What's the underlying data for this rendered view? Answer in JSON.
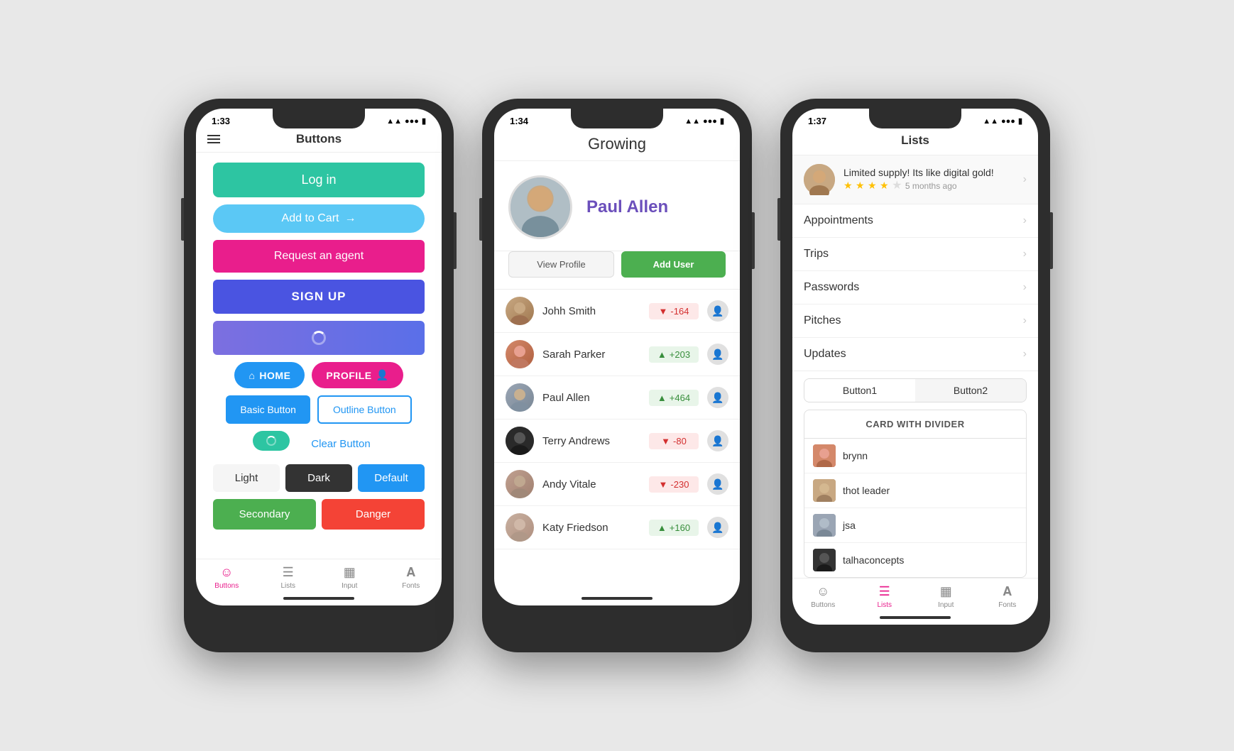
{
  "phone1": {
    "status_time": "1:33",
    "header_title": "Buttons",
    "buttons": {
      "login": "Log in",
      "add_cart": "Add to Cart",
      "request_agent": "Request an agent",
      "signup": "SIGN UP",
      "home": "HOME",
      "profile": "PROFILE",
      "basic": "Basic Button",
      "outline": "Outline Button",
      "clear": "Clear Button",
      "light": "Light",
      "dark": "Dark",
      "default": "Default",
      "secondary": "Secondary",
      "danger": "Danger"
    },
    "tabs": [
      "Buttons",
      "Lists",
      "Input",
      "Fonts"
    ]
  },
  "phone2": {
    "status_time": "1:34",
    "header_title": "Growing",
    "profile_name": "Paul Allen",
    "btn_view_profile": "View Profile",
    "btn_add_user": "Add User",
    "users": [
      {
        "name": "Johh Smith",
        "score": "-164",
        "positive": false
      },
      {
        "name": "Sarah Parker",
        "score": "+203",
        "positive": true
      },
      {
        "name": "Paul Allen",
        "score": "+464",
        "positive": true
      },
      {
        "name": "Terry Andrews",
        "score": "-80",
        "positive": false
      },
      {
        "name": "Andy Vitale",
        "score": "-230",
        "positive": false
      },
      {
        "name": "Katy Friedson",
        "score": "+160",
        "positive": true
      }
    ]
  },
  "phone3": {
    "status_time": "1:37",
    "header_title": "Lists",
    "promo": {
      "title": "Limited supply! Its like digital gold!",
      "time": "5 months ago",
      "stars": 4
    },
    "list_items": [
      "Appointments",
      "Trips",
      "Passwords",
      "Pitches",
      "Updates"
    ],
    "seg_buttons": [
      "Button1",
      "Button2"
    ],
    "card_title": "CARD WITH DIVIDER",
    "card_items": [
      "brynn",
      "thot leader",
      "jsa",
      "talhaconcepts"
    ],
    "tabs": [
      "Buttons",
      "Lists",
      "Input",
      "Fonts"
    ]
  }
}
